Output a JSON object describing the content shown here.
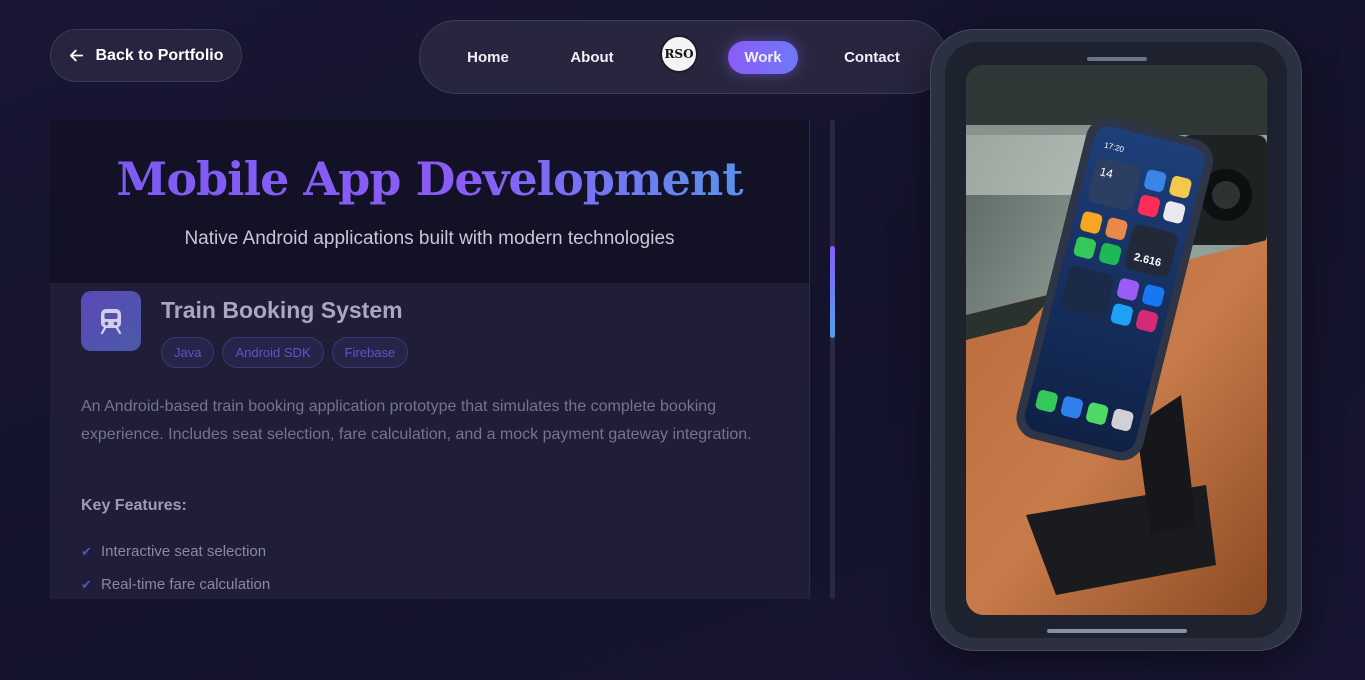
{
  "back_button": {
    "label": "Back to Portfolio",
    "icon": "arrow-left-icon"
  },
  "nav": {
    "items": [
      "Home",
      "About",
      "Work",
      "Contact"
    ],
    "logo_text": "RSO",
    "active": "Work"
  },
  "section": {
    "title": "Mobile App Development",
    "subtitle": "Native Android applications built with modern technologies"
  },
  "project": {
    "icon": "train-icon",
    "title": "Train Booking System",
    "tags": [
      "Java",
      "Android SDK",
      "Firebase"
    ],
    "description": "An Android-based train booking application prototype that simulates the complete booking experience. Includes seat selection, fare calculation, and a mock payment gateway integration.",
    "features_title": "Key Features:",
    "features": [
      "Interactive seat selection",
      "Real-time fare calculation"
    ]
  },
  "phone_screen": {
    "time": "17:20",
    "date": "14",
    "counter": "2.616"
  },
  "colors": {
    "accent_purple": "#8b5cf6",
    "accent_blue": "#4f9ee8",
    "background": "#171530"
  }
}
